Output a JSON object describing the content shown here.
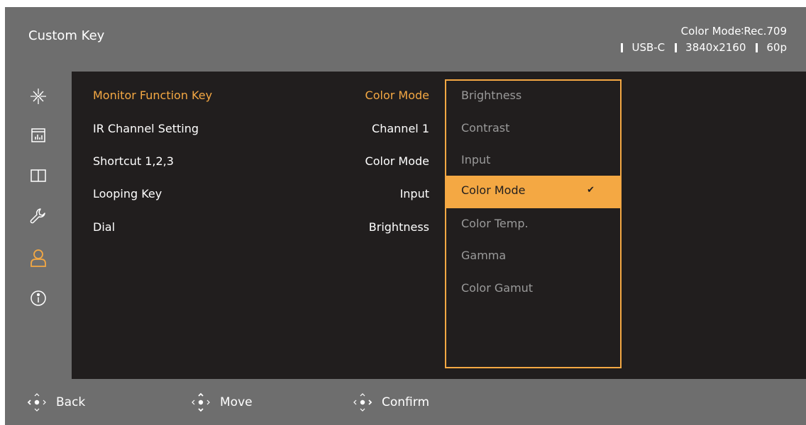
{
  "header": {
    "title": "Custom Key",
    "color_mode_status": "Color Mode∶Rec.709",
    "input": "USB-C",
    "resolution": "3840x2160",
    "refresh": "60p"
  },
  "sidebar": {
    "icons": [
      {
        "name": "picture-mode-icon",
        "active": false
      },
      {
        "name": "display-icon",
        "active": false
      },
      {
        "name": "pip-icon",
        "active": false
      },
      {
        "name": "system-wrench-icon",
        "active": false
      },
      {
        "name": "user-icon",
        "active": true
      },
      {
        "name": "info-icon",
        "active": false
      }
    ]
  },
  "menu": {
    "items": [
      {
        "label": "Monitor Function Key",
        "value": "Color Mode",
        "active": true
      },
      {
        "label": "IR Channel Setting",
        "value": "Channel 1",
        "active": false
      },
      {
        "label": "Shortcut 1,2,3",
        "value": "Color Mode",
        "active": false
      },
      {
        "label": "Looping Key",
        "value": "Input",
        "active": false
      },
      {
        "label": "Dial",
        "value": "Brightness",
        "active": false
      }
    ]
  },
  "dropdown": {
    "options": [
      "Brightness",
      "Contrast",
      "Input",
      "Color Mode",
      "Color Temp.",
      "Gamma",
      "Color Gamut"
    ],
    "selected": "Color Mode",
    "check_glyph": "✔"
  },
  "footer": {
    "back": "Back",
    "move": "Move",
    "confirm": "Confirm"
  },
  "colors": {
    "accent": "#f4a843",
    "panel": "#6e6e6e",
    "background": "#211e1e"
  }
}
